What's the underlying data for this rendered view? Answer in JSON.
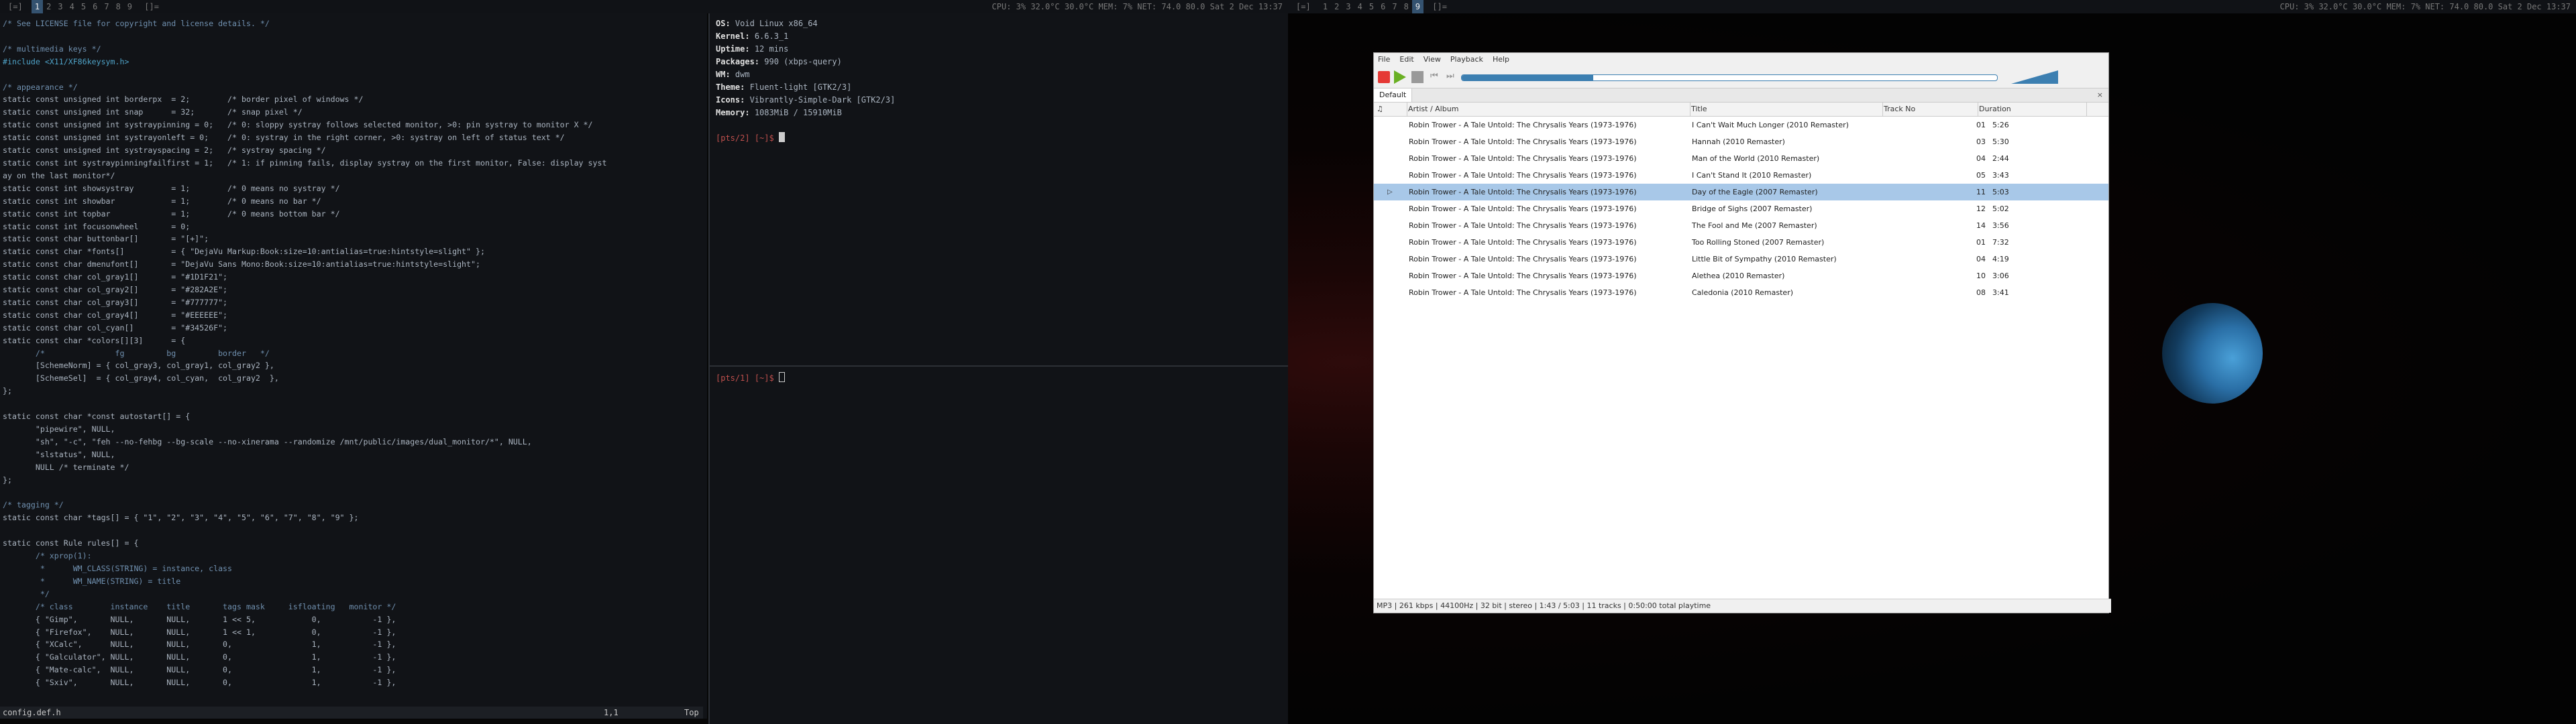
{
  "bar_left": {
    "prefix": "[=]",
    "tags": [
      "1",
      "2",
      "3",
      "4",
      "5",
      "6",
      "7",
      "8",
      "9"
    ],
    "selected_tag": 0,
    "layout": "[]=",
    "status": "CPU:   3%    32.0°C    30.0°C    MEM:    7%    NET:  74.0        80.0        Sat   2 Dec  13:37"
  },
  "bar_right": {
    "prefix": "[=]",
    "tags": [
      "1",
      "2",
      "3",
      "4",
      "5",
      "6",
      "7",
      "8",
      "9"
    ],
    "selected_tag": 8,
    "layout": "[]=",
    "status": "CPU:   3%    32.0°C    30.0°C    MEM:    7%    NET:  74.0        80.0        Sat   2 Dec  13:37"
  },
  "editor": {
    "lines": [
      "/* See LICENSE file for copyright and license details. */",
      "",
      "/* multimedia keys */",
      "#include <X11/XF86keysym.h>",
      "",
      "/* appearance */",
      "static const unsigned int borderpx  = 2;        /* border pixel of windows */",
      "static const unsigned int snap      = 32;       /* snap pixel */",
      "static const unsigned int systraypinning = 0;   /* 0: sloppy systray follows selected monitor, >0: pin systray to monitor X */",
      "static const unsigned int systrayonleft = 0;    /* 0: systray in the right corner, >0: systray on left of status text */",
      "static const unsigned int systrayspacing = 2;   /* systray spacing */",
      "static const int systraypinningfailfirst = 1;   /* 1: if pinning fails, display systray on the first monitor, False: display syst",
      "ay on the last monitor*/",
      "static const int showsystray        = 1;        /* 0 means no systray */",
      "static const int showbar            = 1;        /* 0 means no bar */",
      "static const int topbar             = 1;        /* 0 means bottom bar */",
      "static const int focusonwheel       = 0;",
      "static const char buttonbar[]       = \"[+]\";",
      "static const char *fonts[]          = { \"DejaVu Markup:Book:size=10:antialias=true:hintstyle=slight\" };",
      "static const char dmenufont[]       = \"DejaVu Sans Mono:Book:size=10:antialias=true:hintstyle=slight\";",
      "static const char col_gray1[]       = \"#1D1F21\";",
      "static const char col_gray2[]       = \"#282A2E\";",
      "static const char col_gray3[]       = \"#777777\";",
      "static const char col_gray4[]       = \"#EEEEEE\";",
      "static const char col_cyan[]        = \"#34526F\";",
      "static const char *colors[][3]      = {",
      "       /*               fg         bg         border   */",
      "       [SchemeNorm] = { col_gray3, col_gray1, col_gray2 },",
      "       [SchemeSel]  = { col_gray4, col_cyan,  col_gray2  },",
      "};",
      "",
      "static const char *const autostart[] = {",
      "       \"pipewire\", NULL,",
      "       \"sh\", \"-c\", \"feh --no-fehbg --bg-scale --no-xinerama --randomize /mnt/public/images/dual_monitor/*\", NULL,",
      "       \"slstatus\", NULL,",
      "       NULL /* terminate */",
      "};",
      "",
      "/* tagging */",
      "static const char *tags[] = { \"1\", \"2\", \"3\", \"4\", \"5\", \"6\", \"7\", \"8\", \"9\" };",
      "",
      "static const Rule rules[] = {",
      "       /* xprop(1):",
      "        *      WM_CLASS(STRING) = instance, class",
      "        *      WM_NAME(STRING) = title",
      "        */",
      "       /* class        instance    title       tags mask     isfloating   monitor */",
      "       { \"Gimp\",       NULL,       NULL,       1 << 5,            0,           -1 },",
      "       { \"Firefox\",    NULL,       NULL,       1 << 1,            0,           -1 },",
      "       { \"XCalc\",      NULL,       NULL,       0,                 1,           -1 },",
      "       { \"Galculator\", NULL,       NULL,       0,                 1,           -1 },",
      "       { \"Mate-calc\",  NULL,       NULL,       0,                 1,           -1 },",
      "       { \"Sxiv\",       NULL,       NULL,       0,                 1,           -1 },"
    ],
    "status_file": "config.def.h",
    "status_pos": "1,1",
    "status_scroll": "Top"
  },
  "fetch": {
    "rows": [
      {
        "key": "OS",
        "value": "Void Linux x86_64"
      },
      {
        "key": "Kernel",
        "value": "6.6.3_1"
      },
      {
        "key": "Uptime",
        "value": "12 mins"
      },
      {
        "key": "Packages",
        "value": "990 (xbps-query)"
      },
      {
        "key": "WM",
        "value": "dwm"
      },
      {
        "key": "Theme",
        "value": "Fluent-light [GTK2/3]"
      },
      {
        "key": "Icons",
        "value": "Vibrantly-Simple-Dark [GTK2/3]"
      },
      {
        "key": "Memory",
        "value": "1083MiB / 15910MiB"
      }
    ],
    "prompt_tty": "[pts/2]",
    "prompt_dir": "[~]$"
  },
  "term2": {
    "prompt_tty": "[pts/1]",
    "prompt_dir": "[~]$"
  },
  "player": {
    "menu": [
      "File",
      "Edit",
      "View",
      "Playback",
      "Help"
    ],
    "progress": 0.245,
    "tab": "Default",
    "tab_close": "×",
    "columns": [
      "♫",
      "Artist / Album",
      "Title",
      "Track No",
      "Duration"
    ],
    "playing_index": 4,
    "tracks": [
      {
        "artist": "Robin Trower - A Tale Untold: The Chrysalis Years (1973-1976)",
        "title": "I Can't Wait Much Longer (2010 Remaster)",
        "track": "01",
        "duration": "5:26"
      },
      {
        "artist": "Robin Trower - A Tale Untold: The Chrysalis Years (1973-1976)",
        "title": "Hannah (2010 Remaster)",
        "track": "03",
        "duration": "5:30"
      },
      {
        "artist": "Robin Trower - A Tale Untold: The Chrysalis Years (1973-1976)",
        "title": "Man of the World (2010 Remaster)",
        "track": "04",
        "duration": "2:44"
      },
      {
        "artist": "Robin Trower - A Tale Untold: The Chrysalis Years (1973-1976)",
        "title": "I Can't Stand It (2010 Remaster)",
        "track": "05",
        "duration": "3:43"
      },
      {
        "artist": "Robin Trower - A Tale Untold: The Chrysalis Years (1973-1976)",
        "title": "Day of the Eagle (2007 Remaster)",
        "track": "11",
        "duration": "5:03"
      },
      {
        "artist": "Robin Trower - A Tale Untold: The Chrysalis Years (1973-1976)",
        "title": "Bridge of Sighs (2007 Remaster)",
        "track": "12",
        "duration": "5:02"
      },
      {
        "artist": "Robin Trower - A Tale Untold: The Chrysalis Years (1973-1976)",
        "title": "The Fool and Me (2007 Remaster)",
        "track": "14",
        "duration": "3:56"
      },
      {
        "artist": "Robin Trower - A Tale Untold: The Chrysalis Years (1973-1976)",
        "title": "Too Rolling Stoned (2007 Remaster)",
        "track": "01",
        "duration": "7:32"
      },
      {
        "artist": "Robin Trower - A Tale Untold: The Chrysalis Years (1973-1976)",
        "title": "Little Bit of Sympathy (2010 Remaster)",
        "track": "04",
        "duration": "4:19"
      },
      {
        "artist": "Robin Trower - A Tale Untold: The Chrysalis Years (1973-1976)",
        "title": "Alethea (2010 Remaster)",
        "track": "10",
        "duration": "3:06"
      },
      {
        "artist": "Robin Trower - A Tale Untold: The Chrysalis Years (1973-1976)",
        "title": "Caledonia (2010 Remaster)",
        "track": "08",
        "duration": "3:41"
      }
    ],
    "status": "MP3 | 261 kbps | 44100Hz | 32 bit | stereo | 1:43 / 5:03 | 11 tracks | 0:50:00 total playtime",
    "colors": {
      "selected_row": "#a8c8e8",
      "seek": "#3c7fb1",
      "stop": "#e53935",
      "play": "#6ab023"
    }
  }
}
